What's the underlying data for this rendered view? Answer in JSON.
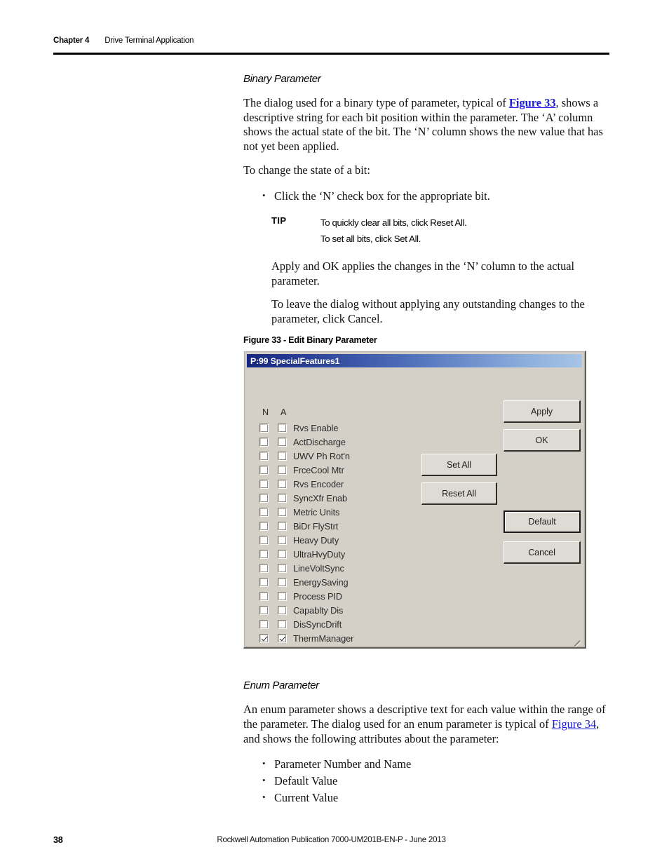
{
  "header": {
    "chapter": "Chapter 4",
    "title": "Drive Terminal Application"
  },
  "sections": {
    "binary": {
      "heading": "Binary Parameter",
      "para1_before": "The dialog used for a binary type of parameter, typical of ",
      "para1_link": "Figure 33",
      "para1_after": ", shows a descriptive string for each bit position within the parameter. The ‘A’ column shows the actual state of the bit. The ‘N’ column shows the new value that has not yet been applied.",
      "para2": "To change the state of a bit:",
      "bullet1": "Click the ‘N’ check box for the appropriate bit.",
      "tip_label": "TIP",
      "tip_line1": "To quickly clear all bits, click Reset All.",
      "tip_line2": "To set all bits, click Set All.",
      "para3": "Apply and OK applies the changes in the ‘N’ column to the actual parameter.",
      "para4": "To leave the dialog without applying any outstanding changes to the parameter, click Cancel.",
      "figure_caption": "Figure 33 - Edit Binary Parameter"
    },
    "enum": {
      "heading": "Enum Parameter",
      "para1_before": "An enum parameter shows a descriptive text for each value within the range of the parameter. The dialog used for an enum parameter is typical of ",
      "para1_link": "Figure 34",
      "para1_after": ", and shows the following attributes about the parameter:",
      "bullets": [
        "Parameter Number and Name",
        "Default Value",
        "Current Value"
      ]
    }
  },
  "dialog": {
    "title": "P:99 SpecialFeatures1",
    "column_heads": {
      "n": "N",
      "a": "A"
    },
    "bits": [
      {
        "label": "Rvs Enable",
        "n": false,
        "a": false
      },
      {
        "label": "ActDischarge",
        "n": false,
        "a": false
      },
      {
        "label": "UWV Ph Rot'n",
        "n": false,
        "a": false
      },
      {
        "label": "FrceCool Mtr",
        "n": false,
        "a": false
      },
      {
        "label": "Rvs Encoder",
        "n": false,
        "a": false
      },
      {
        "label": "SyncXfr Enab",
        "n": false,
        "a": false
      },
      {
        "label": "Metric Units",
        "n": false,
        "a": false
      },
      {
        "label": "BiDr FlyStrt",
        "n": false,
        "a": false
      },
      {
        "label": "Heavy Duty",
        "n": false,
        "a": false
      },
      {
        "label": "UltraHvyDuty",
        "n": false,
        "a": false
      },
      {
        "label": "LineVoltSync",
        "n": false,
        "a": false
      },
      {
        "label": "EnergySaving",
        "n": false,
        "a": false
      },
      {
        "label": "Process PID",
        "n": false,
        "a": false
      },
      {
        "label": "Capablty Dis",
        "n": false,
        "a": false
      },
      {
        "label": "DisSyncDrift",
        "n": false,
        "a": false
      },
      {
        "label": "ThermManager",
        "n": true,
        "a": true
      }
    ],
    "buttons": {
      "apply": "Apply",
      "ok": "OK",
      "set_all": "Set All",
      "reset_all": "Reset All",
      "default": "Default",
      "cancel": "Cancel"
    },
    "colors": {
      "face": "#d4d0c8",
      "titlebar_left": "#16267f",
      "titlebar_right": "#a8c4e6",
      "titlebar_text": "#ffffff"
    }
  },
  "footer": {
    "page_number": "38",
    "publication": "Rockwell Automation Publication 7000-UM201B-EN-P - June 2013"
  }
}
